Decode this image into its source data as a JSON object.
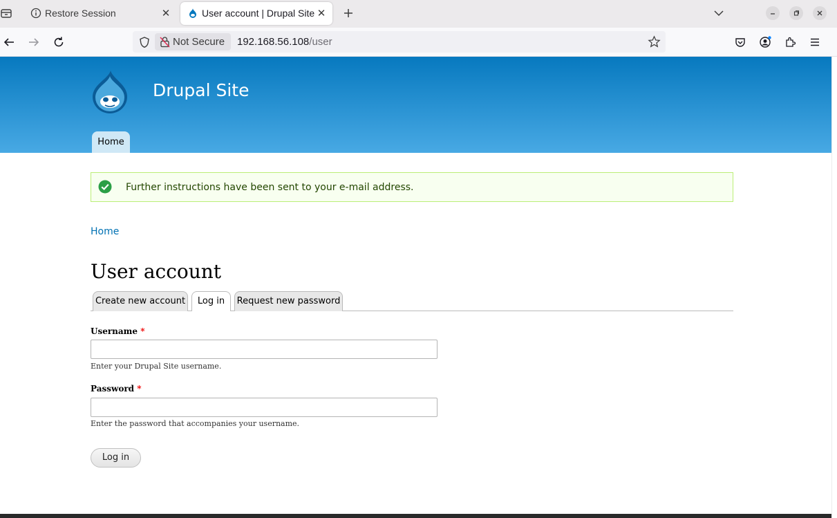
{
  "browser": {
    "tabs": [
      {
        "title": "Restore Session",
        "icon": "info-icon",
        "close": "✕"
      },
      {
        "title": "User account | Drupal Site",
        "icon": "drupal-drop-icon",
        "close": "✕"
      }
    ],
    "not_secure_label": "Not Secure",
    "url_host": "192.168.56.108",
    "url_path": "/user"
  },
  "site": {
    "name": "Drupal Site",
    "nav": [
      {
        "label": "Home"
      }
    ]
  },
  "message": {
    "text": "Further instructions have been sent to your e-mail address.",
    "status": "success",
    "icon": "check-circle-icon"
  },
  "breadcrumb": {
    "home": "Home"
  },
  "page": {
    "title": "User account",
    "tabs": [
      {
        "label": "Create new account",
        "active": false
      },
      {
        "label": "Log in",
        "active": true
      },
      {
        "label": "Request new password",
        "active": false
      }
    ]
  },
  "form": {
    "username": {
      "label": "Username",
      "required_mark": "*",
      "value": "",
      "description": "Enter your Drupal Site username."
    },
    "password": {
      "label": "Password",
      "required_mark": "*",
      "value": "",
      "description": "Enter the password that accompanies your username."
    },
    "submit_label": "Log in"
  },
  "colors": {
    "header_top": "#0779bf",
    "header_bottom": "#48a9e4",
    "link": "#0071b3",
    "message_bg": "#f8fff0",
    "message_border": "#bbee77",
    "required": "#ee0000"
  }
}
